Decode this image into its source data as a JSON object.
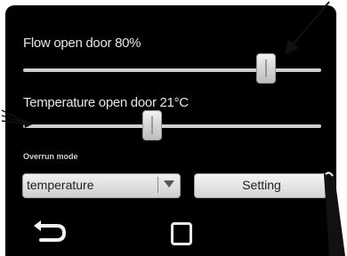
{
  "flow": {
    "label": "Flow open door 80%",
    "value_percent": 80
  },
  "temperature": {
    "label": "Temperature open door 21°C",
    "value_celsius": 21
  },
  "overrun": {
    "label": "Overrun mode",
    "selected": "temperature",
    "setting_label": "Setting"
  },
  "nav": {
    "back": "back-arrow-icon",
    "home": "home-square-icon"
  }
}
